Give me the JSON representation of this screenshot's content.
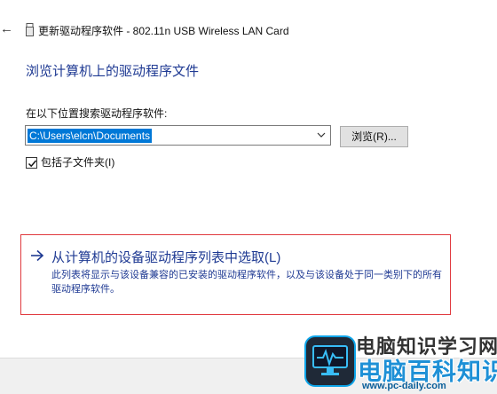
{
  "window": {
    "back_glyph": "←",
    "title": "更新驱动程序软件 - 802.11n USB Wireless LAN Card"
  },
  "page": {
    "heading": "浏览计算机上的驱动程序文件"
  },
  "search": {
    "label": "在以下位置搜索驱动程序软件:",
    "path_value": "C:\\Users\\elcn\\Documents",
    "browse_button": "浏览(R)..."
  },
  "options": {
    "include_subfolders_label": "包括子文件夹(I)",
    "include_subfolders_checked": true
  },
  "pick_from_list": {
    "title": "从计算机的设备驱动程序列表中选取(L)",
    "description": "此列表将显示与该设备兼容的已安装的驱动程序软件，以及与该设备处于同一类别下的所有驱动程序软件。"
  },
  "watermark": {
    "line1": "电脑知识学习网",
    "line2": "电脑百科知识",
    "url": "www.pc-daily.com"
  },
  "colors": {
    "link_blue": "#1f3a93",
    "selection_blue": "#0078d7",
    "highlight_red": "#e0393e"
  }
}
